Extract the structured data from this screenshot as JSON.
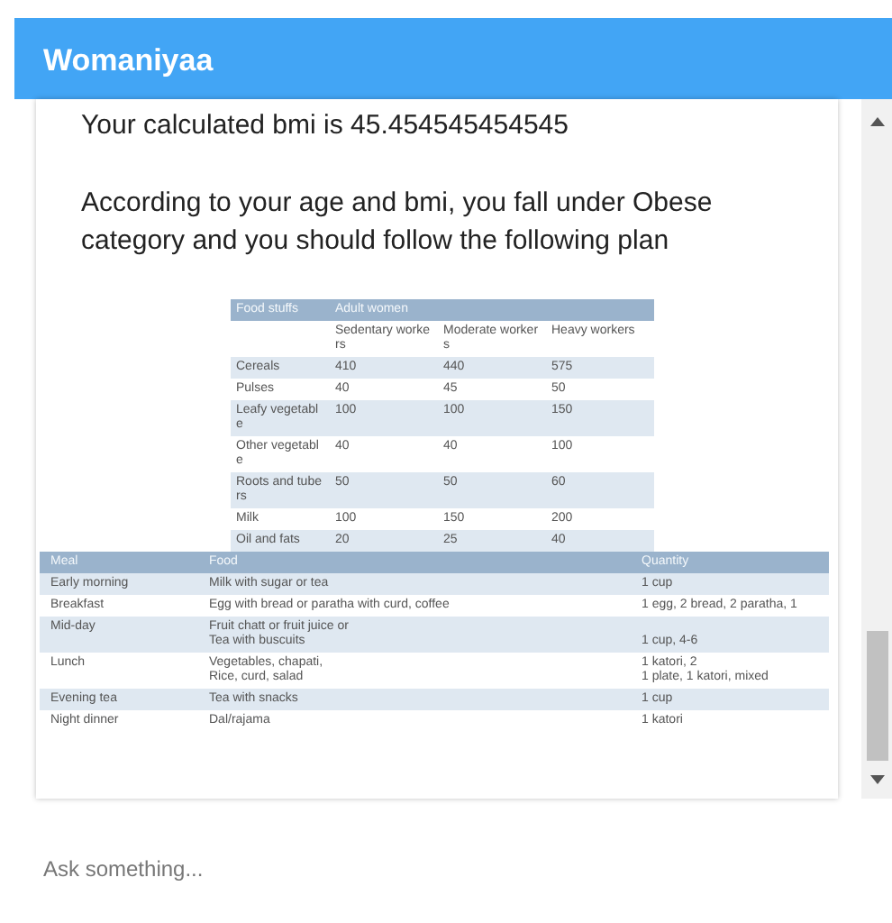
{
  "app_bar": {
    "title": "Womaniyaa"
  },
  "message": {
    "bmi_text": "Your calculated bmi is 45.454545454545",
    "plan_text": "According to your age and bmi, you fall under Obese category and you should follow the following plan",
    "food_table": {
      "header": [
        "Food stuffs",
        "Adult women"
      ],
      "subheader": [
        "Sedentary workers",
        "Moderate workers",
        "Heavy workers"
      ],
      "rows": [
        [
          "Cereals",
          "410",
          "440",
          "575"
        ],
        [
          "Pulses",
          "40",
          "45",
          "50"
        ],
        [
          "Leafy vegetable",
          "100",
          "100",
          "150"
        ],
        [
          "Other vegetable",
          "40",
          "40",
          "100"
        ],
        [
          "Roots and tubers",
          "50",
          "50",
          "60"
        ],
        [
          "Milk",
          "100",
          "150",
          "200"
        ],
        [
          "Oil and fats",
          "20",
          "25",
          "40"
        ]
      ]
    },
    "meal_table": {
      "columns": [
        "Meal",
        "Food",
        "Quantity"
      ],
      "rows": [
        [
          "Early morning",
          "Milk with sugar or tea",
          "1 cup"
        ],
        [
          "Breakfast",
          "Egg with bread or paratha with curd, coffee",
          "1 egg, 2 bread, 2 paratha, 1"
        ],
        [
          "Mid-day",
          "Fruit chatt or fruit juice or\nTea with buscuits",
          "\n1 cup, 4-6"
        ],
        [
          "Lunch",
          "Vegetables, chapati,\nRice, curd, salad",
          "1 katori, 2\n1 plate, 1 katori, mixed"
        ],
        [
          "Evening tea",
          "Tea with snacks",
          "1 cup"
        ],
        [
          "Night dinner",
          "Dal/rajama",
          "1 katori"
        ]
      ]
    }
  },
  "input": {
    "placeholder": "Ask something..."
  }
}
